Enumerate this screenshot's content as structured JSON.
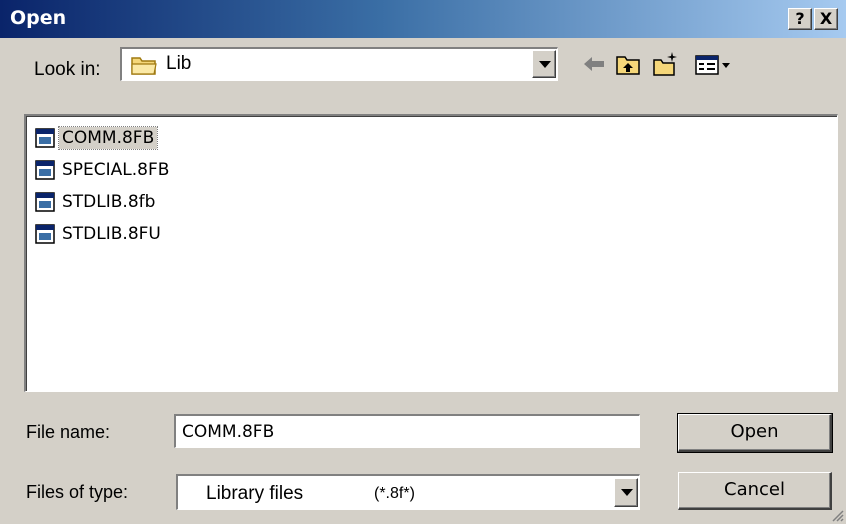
{
  "window": {
    "title": "Open",
    "help_button": "?",
    "close_button": "X"
  },
  "lookin": {
    "label": "Look in:",
    "value": "Lib",
    "icon": "folder-icon"
  },
  "toolbar": {
    "back_icon": "back-arrow-icon",
    "up_icon": "up-folder-icon",
    "new_folder_icon": "new-folder-icon",
    "view_icon": "view-menu-icon"
  },
  "files": [
    {
      "name": "COMM.8FB",
      "selected": true
    },
    {
      "name": "SPECIAL.8FB",
      "selected": false
    },
    {
      "name": "STDLIB.8fb",
      "selected": false
    },
    {
      "name": "STDLIB.8FU",
      "selected": false
    }
  ],
  "filename": {
    "label": "File name:",
    "value": "COMM.8FB"
  },
  "filetype": {
    "label": "Files of type:",
    "name": "Library files",
    "pattern": "(*.8f*)"
  },
  "buttons": {
    "open": "Open",
    "cancel": "Cancel"
  },
  "colors": {
    "titlebar_start": "#0a246a",
    "titlebar_end": "#a6caf0",
    "face": "#d4d0c8"
  }
}
